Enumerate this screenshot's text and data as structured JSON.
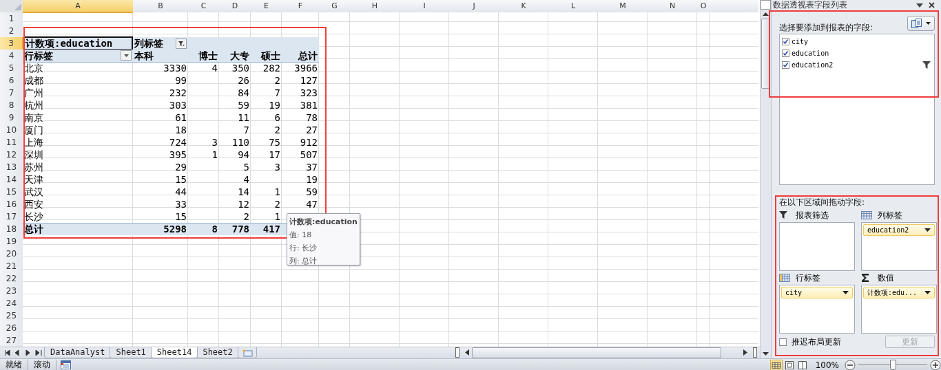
{
  "columns": [
    {
      "label": "A",
      "selected": true
    },
    {
      "label": "B",
      "selected": false
    },
    {
      "label": "C",
      "selected": false
    },
    {
      "label": "D",
      "selected": false
    },
    {
      "label": "E",
      "selected": false
    },
    {
      "label": "F",
      "selected": false
    },
    {
      "label": "G",
      "selected": false
    },
    {
      "label": "H",
      "selected": false
    },
    {
      "label": "I",
      "selected": false
    },
    {
      "label": "J",
      "selected": false
    },
    {
      "label": "K",
      "selected": false
    },
    {
      "label": "L",
      "selected": false
    },
    {
      "label": "M",
      "selected": false
    },
    {
      "label": "N",
      "selected": false
    },
    {
      "label": "O",
      "selected": false
    }
  ],
  "row_headers": [
    {
      "label": "1",
      "selected": false
    },
    {
      "label": "2",
      "selected": false
    },
    {
      "label": "3",
      "selected": true
    },
    {
      "label": "4",
      "selected": false
    },
    {
      "label": "5",
      "selected": false
    },
    {
      "label": "6",
      "selected": false
    },
    {
      "label": "7",
      "selected": false
    },
    {
      "label": "8",
      "selected": false
    },
    {
      "label": "9",
      "selected": false
    },
    {
      "label": "10",
      "selected": false
    },
    {
      "label": "11",
      "selected": false
    },
    {
      "label": "12",
      "selected": false
    },
    {
      "label": "13",
      "selected": false
    },
    {
      "label": "14",
      "selected": false
    },
    {
      "label": "15",
      "selected": false
    },
    {
      "label": "16",
      "selected": false
    },
    {
      "label": "17",
      "selected": false
    },
    {
      "label": "18",
      "selected": false
    },
    {
      "label": "19",
      "selected": false
    },
    {
      "label": "20",
      "selected": false
    },
    {
      "label": "21",
      "selected": false
    },
    {
      "label": "22",
      "selected": false
    },
    {
      "label": "23",
      "selected": false
    },
    {
      "label": "24",
      "selected": false
    },
    {
      "label": "25",
      "selected": false
    },
    {
      "label": "26",
      "selected": false
    },
    {
      "label": "27",
      "selected": false
    }
  ],
  "pivot": {
    "data_field": {
      "text": "计数项:education",
      "selected": true
    },
    "column_label": "列标签",
    "row_label": "行标签",
    "column_headers": [
      "本科",
      "博士",
      "大专",
      "硕士",
      "总计"
    ],
    "rows": [
      {
        "label": "北京",
        "bachelor": "3330",
        "doctorate": "4",
        "associate": "350",
        "master": "282",
        "total": "3966"
      },
      {
        "label": "成都",
        "bachelor": "99",
        "associate": "26",
        "master": "2",
        "total": "127"
      },
      {
        "label": "广州",
        "bachelor": "232",
        "associate": "84",
        "master": "7",
        "total": "323"
      },
      {
        "label": "杭州",
        "bachelor": "303",
        "associate": "59",
        "master": "19",
        "total": "381"
      },
      {
        "label": "南京",
        "bachelor": "61",
        "associate": "11",
        "master": "6",
        "total": "78"
      },
      {
        "label": "厦门",
        "bachelor": "18",
        "associate": "7",
        "master": "2",
        "total": "27"
      },
      {
        "label": "上海",
        "bachelor": "724",
        "doctorate": "3",
        "associate": "110",
        "master": "75",
        "total": "912"
      },
      {
        "label": "深圳",
        "bachelor": "395",
        "doctorate": "1",
        "associate": "94",
        "master": "17",
        "total": "507"
      },
      {
        "label": "苏州",
        "bachelor": "29",
        "associate": "5",
        "master": "3",
        "total": "37"
      },
      {
        "label": "天津",
        "bachelor": "15",
        "associate": "4",
        "total": "19"
      },
      {
        "label": "武汉",
        "bachelor": "44",
        "associate": "14",
        "master": "1",
        "total": "59"
      },
      {
        "label": "西安",
        "bachelor": "33",
        "associate": "12",
        "master": "2",
        "total": "47"
      },
      {
        "label": "长沙",
        "bachelor": "15",
        "associate": "2",
        "master": "1"
      }
    ],
    "total": {
      "label": "总计",
      "bachelor": "5298",
      "doctorate": "8",
      "associate": "778",
      "master": "417"
    }
  },
  "tooltip": {
    "title": "计数项:education",
    "lines": [
      "值: 18",
      "行: 长沙",
      "列: 总计"
    ]
  },
  "sheet_tabs": [
    {
      "label": "DataAnalyst",
      "selected": false
    },
    {
      "label": "Sheet1",
      "selected": false
    },
    {
      "label": "Sheet14",
      "selected": true
    },
    {
      "label": "Sheet2",
      "selected": false
    }
  ],
  "status_bar": {
    "items": [
      "就绪",
      "滚动"
    ],
    "zoom": "100%",
    "zoom_slider": {
      "level": 0.5
    }
  },
  "field_pane": {
    "title": "数据透视表字段列表",
    "fields_label": "选择要添加到报表的字段:",
    "fields": [
      {
        "name": "city",
        "checked": true,
        "filtered": false
      },
      {
        "name": "education",
        "checked": true,
        "filtered": false
      },
      {
        "name": "education2",
        "checked": true,
        "filtered": true
      }
    ],
    "areas_label": "在以下区域间拖动字段:",
    "areas": [
      {
        "kind": "filter",
        "label": "报表筛选"
      },
      {
        "kind": "columns",
        "label": "列标签",
        "items": [
          "education2"
        ]
      },
      {
        "kind": "rows",
        "label": "行标签",
        "items": [
          "city"
        ]
      },
      {
        "kind": "values",
        "label": "数值",
        "items": [
          "计数项:edu..."
        ]
      }
    ],
    "defer": {
      "label": "推迟布局更新",
      "checked": false
    },
    "update_button": {
      "label": "更新",
      "disabled": true
    }
  }
}
